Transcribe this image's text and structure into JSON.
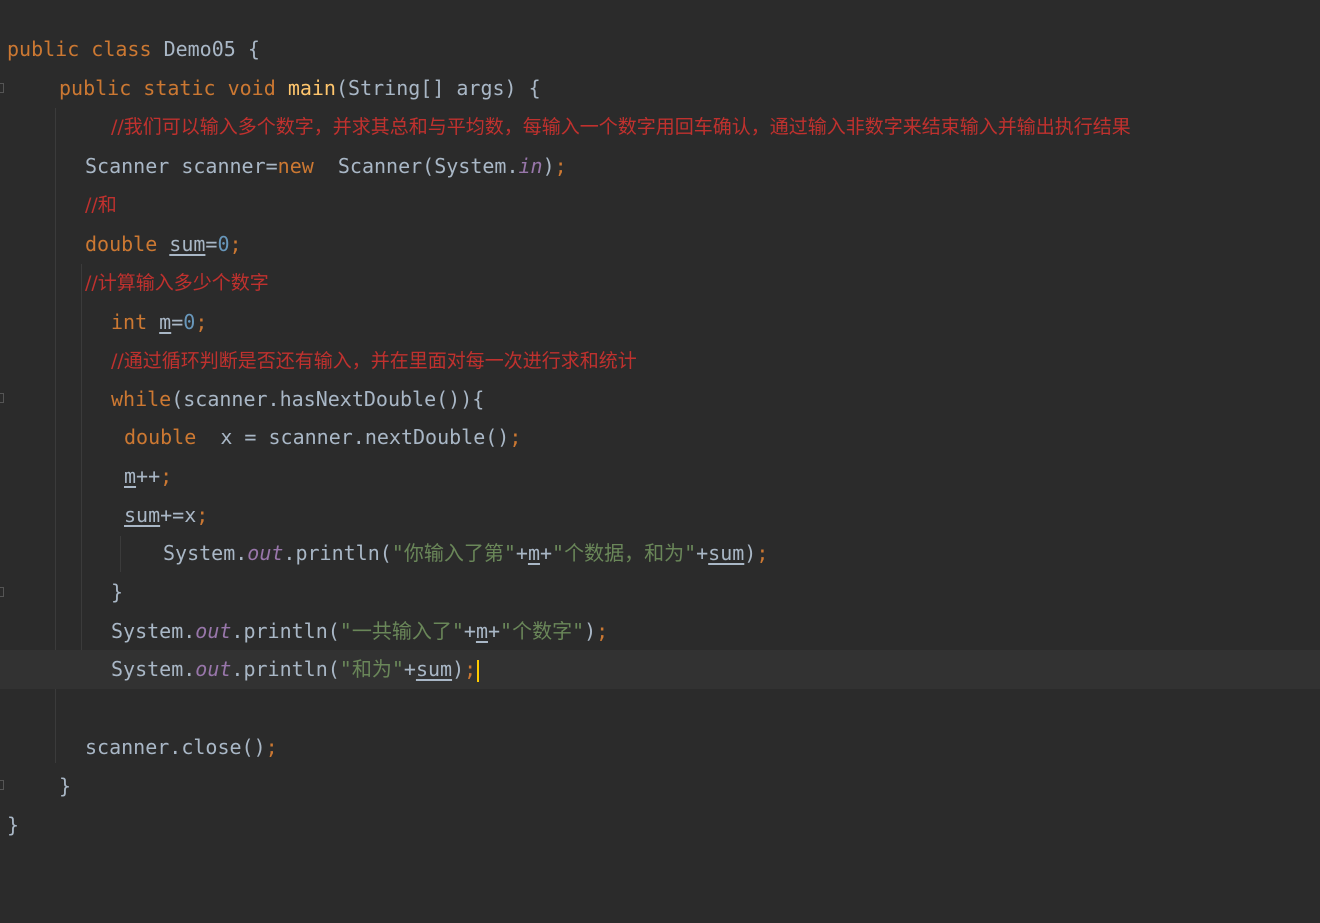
{
  "editor": {
    "language": "Java",
    "colors": {
      "background": "#2b2b2b",
      "keyword": "#cc7832",
      "comment": "#c0312e",
      "string": "#6a8759",
      "number": "#6897bb",
      "method_decl": "#ffc66d",
      "static_field": "#9876aa",
      "plain": "#a9b7c6"
    },
    "line1": {
      "kw1": "public",
      "kw2": "class",
      "name": "Demo05",
      "brace": "{"
    },
    "line2": {
      "kw1": "public",
      "kw2": "static",
      "kw3": "void",
      "method": "main",
      "params": "(String[] args) {"
    },
    "line3": {
      "comment": "//我们可以输入多个数字，并求其总和与平均数，每输入一个数字用回车确认，通过输入非数字来结束输入并输出执行结果"
    },
    "line4": {
      "type": "Scanner scanner=",
      "kw": "new",
      "ctor": "  Scanner(System.",
      "field": "in",
      "close": ")",
      "semi": ";"
    },
    "line5": {
      "comment": "//和"
    },
    "line6": {
      "kw": "double",
      "var": "sum",
      "eq": "=",
      "num": "0",
      "semi": ";"
    },
    "line7": {
      "comment": "//计算输入多少个数字"
    },
    "line8": {
      "kw": "int",
      "var": "m",
      "eq": "=",
      "num": "0",
      "semi": ";"
    },
    "line9": {
      "comment": "//通过循环判断是否还有输入，并在里面对每一次进行求和统计"
    },
    "line10": {
      "kw": "while",
      "rest": "(scanner.hasNextDouble()){"
    },
    "line11": {
      "kw": "double",
      "rest": "  x = scanner.nextDouble()",
      "semi": ";"
    },
    "line12": {
      "var": "m",
      "rest": "++",
      "semi": ";"
    },
    "line13": {
      "var": "sum",
      "rest": "+=x",
      "semi": ";"
    },
    "line14": {
      "pre": "System.",
      "field": "out",
      "call": ".println(",
      "str1": "\"你输入了第\"",
      "plus1": "+",
      "var1": "m",
      "plus2": "+",
      "str2": "\"个数据，和为\"",
      "plus3": "+",
      "var2": "sum",
      "close": ")",
      "semi": ";"
    },
    "line15": {
      "brace": "}"
    },
    "line16": {
      "pre": "System.",
      "field": "out",
      "call": ".println(",
      "str1": "\"一共输入了\"",
      "plus1": "+",
      "var1": "m",
      "plus2": "+",
      "str2": "\"个数字\"",
      "close": ")",
      "semi": ";"
    },
    "line17": {
      "pre": "System.",
      "field": "out",
      "call": ".println(",
      "str1": "\"和为\"",
      "plus1": "+",
      "var1": "sum",
      "close": ")",
      "semi": ";"
    },
    "line19": {
      "text": "scanner.close()",
      "semi": ";"
    },
    "line20": {
      "brace": "}"
    },
    "line21": {
      "brace": "}"
    }
  }
}
